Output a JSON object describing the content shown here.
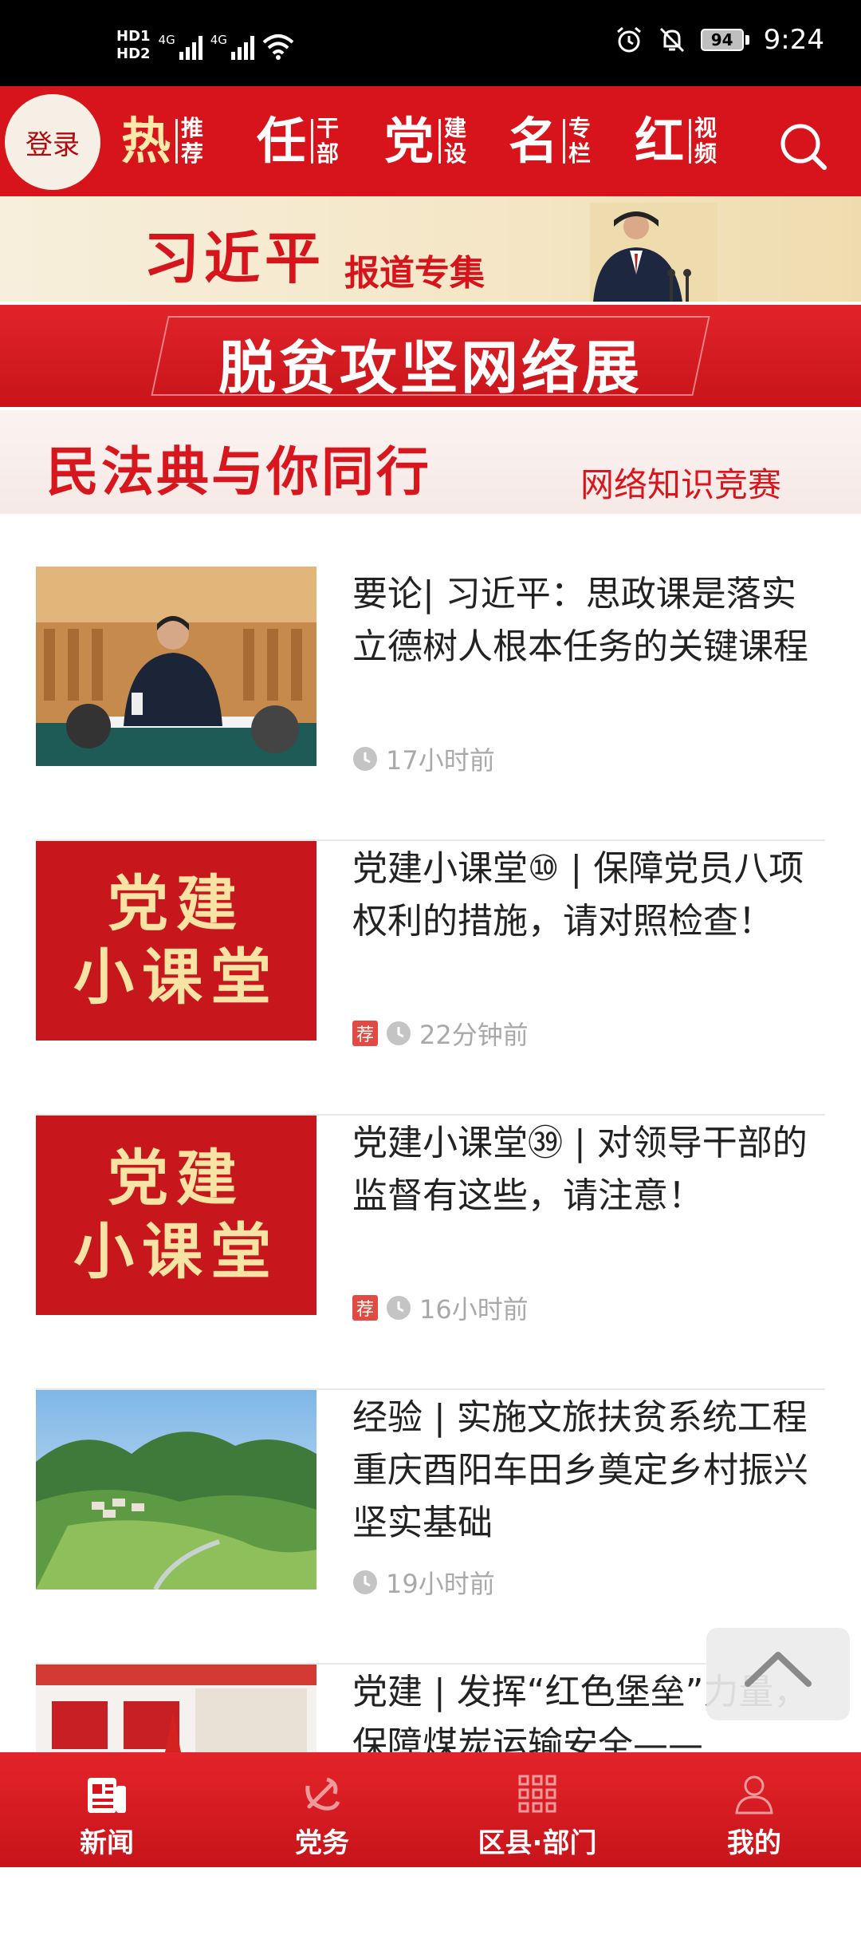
{
  "status_bar": {
    "hd1": "HD1",
    "hd2": "HD2",
    "net1": "4G",
    "net2": "4G",
    "battery": "94",
    "time": "9:24",
    "icons": [
      "signal-icon",
      "wifi-icon",
      "alarm-icon",
      "mute-icon",
      "battery-icon"
    ]
  },
  "header": {
    "login_label": "登录",
    "tabs": [
      {
        "big": "热",
        "small": [
          "推",
          "荐"
        ]
      },
      {
        "big": "任",
        "small": [
          "干",
          "部"
        ]
      },
      {
        "big": "党",
        "small": [
          "建",
          "设"
        ]
      },
      {
        "big": "名",
        "small": [
          "专",
          "栏"
        ]
      },
      {
        "big": "红",
        "small": [
          "视",
          "频"
        ]
      }
    ],
    "search_icon": "search-icon"
  },
  "banners": {
    "b1_title": "习近平",
    "b1_sub": "报道专集",
    "b2_title": "脱贫攻坚网络展",
    "b3_title": "民法典与你同行",
    "b3_sub": "网络知识竞赛"
  },
  "news": [
    {
      "title": "要论| 习近平：思政课是落实立德树人根本任务的关键课程",
      "time": "17小时前",
      "tag": ""
    },
    {
      "title": "党建小课堂⑩ | 保障党员八项权利的措施，请对照检查！",
      "time": "22分钟前",
      "tag": "荐",
      "thumb_line1": "党建",
      "thumb_line2": "小课堂"
    },
    {
      "title": "党建小课堂㊴ | 对领导干部的监督有这些，请注意！",
      "time": "16小时前",
      "tag": "荐",
      "thumb_line1": "党建",
      "thumb_line2": "小课堂"
    },
    {
      "title": "经验 | 实施文旅扶贫系统工程 重庆酉阳车田乡奠定乡村振兴坚实基础",
      "time": "19小时前",
      "tag": ""
    },
    {
      "title": "党建 | 发挥“红色堡垒”力量，保障煤炭运输安全——",
      "time": "",
      "tag": ""
    }
  ],
  "bottom_nav": [
    {
      "label": "新闻",
      "icon": "news-icon"
    },
    {
      "label": "党务",
      "icon": "party-emblem-icon"
    },
    {
      "label": "区县·部门",
      "icon": "grid-icon"
    },
    {
      "label": "我的",
      "icon": "person-icon"
    }
  ],
  "colors": {
    "brand_red": "#d7141b",
    "gold": "#f7e3a4"
  }
}
